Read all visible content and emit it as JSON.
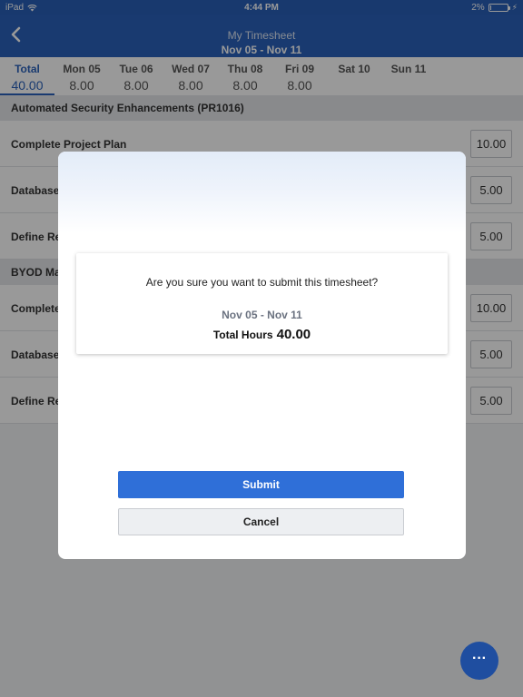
{
  "status_bar": {
    "device": "iPad",
    "time": "4:44 PM",
    "battery": "2%",
    "battery_level": 0.02
  },
  "header": {
    "title": "My Timesheet",
    "range": "Nov 05 - Nov 11"
  },
  "days": [
    {
      "name": "Total",
      "value": "40.00",
      "active": true
    },
    {
      "name": "Mon 05",
      "value": "8.00"
    },
    {
      "name": "Tue 06",
      "value": "8.00"
    },
    {
      "name": "Wed 07",
      "value": "8.00"
    },
    {
      "name": "Thu 08",
      "value": "8.00"
    },
    {
      "name": "Fri 09",
      "value": "8.00"
    },
    {
      "name": "Sat 10",
      "value": ""
    },
    {
      "name": "Sun 11",
      "value": ""
    }
  ],
  "sections": [
    {
      "title": "Automated Security Enhancements (PR1016)",
      "rows": [
        {
          "name": "Complete Project Plan",
          "hours": "10.00"
        },
        {
          "name": "Database",
          "hours": "5.00"
        },
        {
          "name": "Define Re",
          "hours": "5.00"
        }
      ]
    },
    {
      "title": "BYOD Ma",
      "rows": [
        {
          "name": "Complete",
          "hours": "10.00"
        },
        {
          "name": "Database",
          "hours": "5.00"
        },
        {
          "name": "Define Re",
          "hours": "5.00"
        }
      ]
    }
  ],
  "dialog": {
    "question": "Are you sure you want to submit this timesheet?",
    "range": "Nov 05 - Nov 11",
    "total_label": "Total Hours",
    "total_value": "40.00",
    "submit_label": "Submit",
    "cancel_label": "Cancel"
  },
  "fab": {
    "label": "···"
  },
  "colors": {
    "primary": "#2a62bb",
    "submit": "#2f6fd8",
    "fab": "#1f4ea0"
  }
}
